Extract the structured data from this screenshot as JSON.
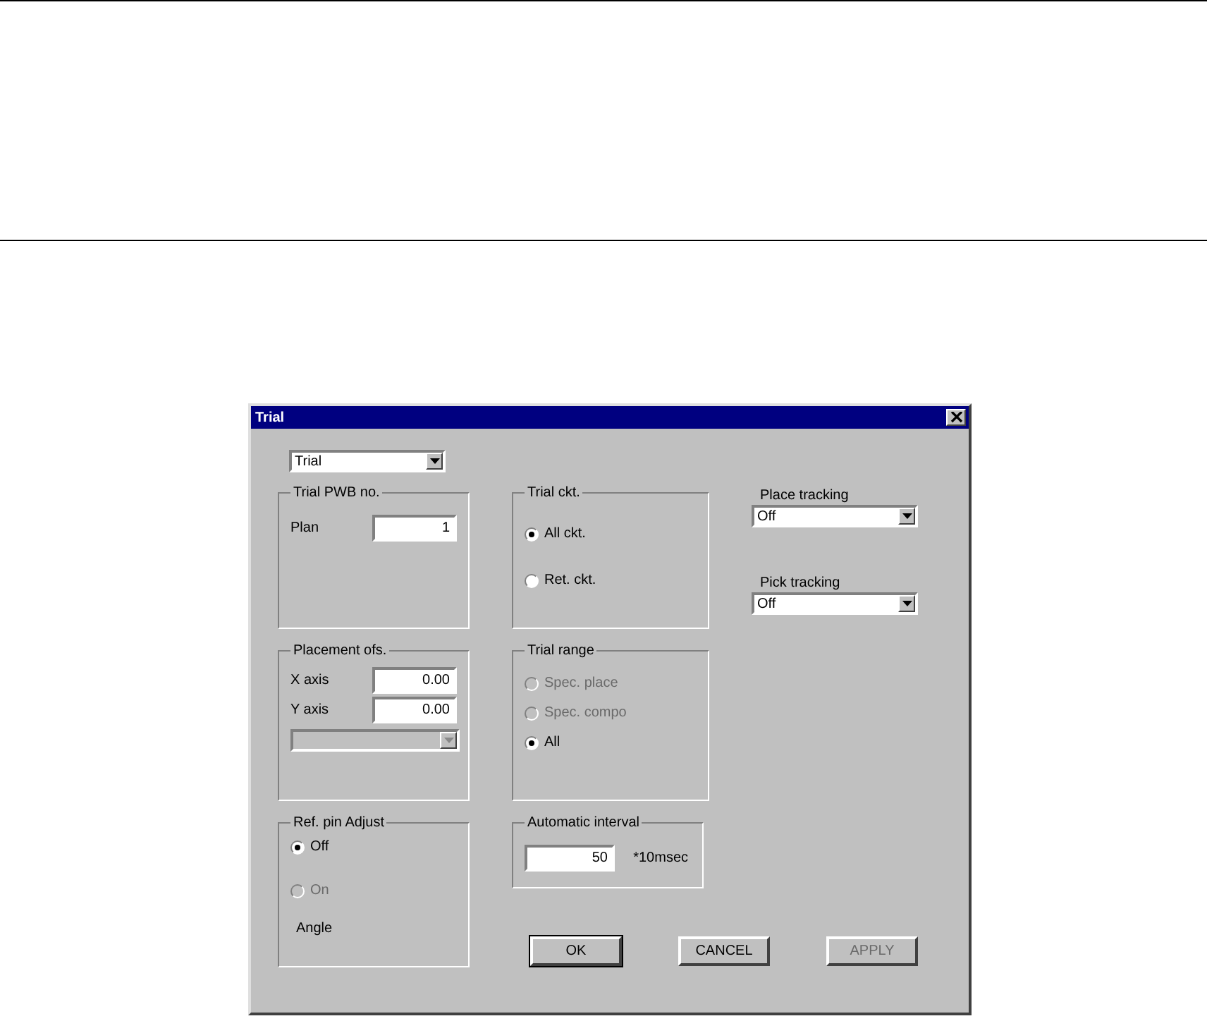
{
  "dialog": {
    "title": "Trial",
    "mode_select": {
      "value": "Trial"
    },
    "trial_pwb": {
      "title": "Trial PWB no.",
      "label": "Plan",
      "value": "1"
    },
    "trial_ckt": {
      "title": "Trial ckt.",
      "options": [
        {
          "label": "All ckt.",
          "selected": true,
          "disabled": false
        },
        {
          "label": "Ret. ckt.",
          "selected": false,
          "disabled": false
        }
      ]
    },
    "place_tracking": {
      "label": "Place tracking",
      "value": "Off"
    },
    "pick_tracking": {
      "label": "Pick tracking",
      "value": "Off"
    },
    "placement_ofs": {
      "title": "Placement ofs.",
      "fields": [
        {
          "label": "X axis",
          "value": "0.00"
        },
        {
          "label": "Y axis",
          "value": "0.00"
        }
      ],
      "dropdown": {
        "disabled": true
      }
    },
    "trial_range": {
      "title": "Trial range",
      "options": [
        {
          "label": "Spec. place",
          "selected": false,
          "disabled": true
        },
        {
          "label": "Spec. compo",
          "selected": false,
          "disabled": true
        },
        {
          "label": "All",
          "selected": true,
          "disabled": false
        }
      ]
    },
    "ref_pin": {
      "title": "Ref. pin Adjust",
      "options": [
        {
          "label": "Off",
          "selected": true,
          "disabled": false
        },
        {
          "label": "On",
          "selected": false,
          "disabled": true
        }
      ],
      "note": "Angle"
    },
    "auto_interval": {
      "title": "Automatic interval",
      "value": "50",
      "unit": "*10msec"
    },
    "buttons": [
      {
        "label": "OK",
        "default": true,
        "disabled": false
      },
      {
        "label": "CANCEL",
        "default": false,
        "disabled": false
      },
      {
        "label": "APPLY",
        "default": false,
        "disabled": true
      }
    ]
  }
}
